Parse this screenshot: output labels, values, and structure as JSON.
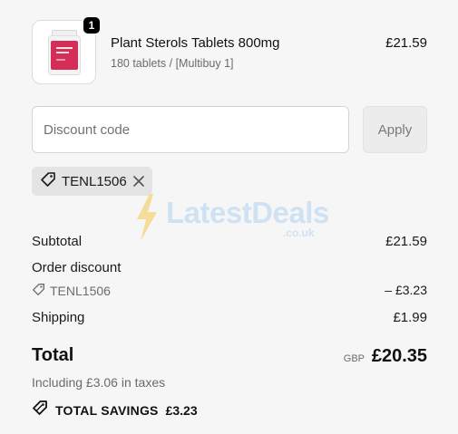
{
  "product": {
    "quantity": "1",
    "name": "Plant Sterols Tablets 800mg",
    "variant": "180 tablets / [Multibuy 1]",
    "price": "£21.59",
    "thumbnail_icon": "supplement-bottle-icon",
    "label_color": "#d42e58"
  },
  "discount": {
    "placeholder": "Discount code",
    "value": "",
    "apply_label": "Apply",
    "applied_code": "TENL1506"
  },
  "summary": {
    "subtotal_label": "Subtotal",
    "subtotal_value": "£21.59",
    "order_discount_label": "Order discount",
    "discount_code": "TENL1506",
    "discount_value": "– £3.23",
    "shipping_label": "Shipping",
    "shipping_value": "£1.99"
  },
  "total": {
    "label": "Total",
    "currency": "GBP",
    "value": "£20.35",
    "taxes_note": "Including £3.06 in taxes",
    "savings_label": "TOTAL SAVINGS",
    "savings_value": "£3.23"
  },
  "watermark": {
    "brand": "LatestDeals",
    "domain": ".co.uk"
  },
  "colors": {
    "background": "#f6f6f6",
    "badge": "#000000",
    "chip": "#e4e4e4",
    "watermark": "#cfe2f3",
    "watermark_bolt": "#f5d78a"
  }
}
